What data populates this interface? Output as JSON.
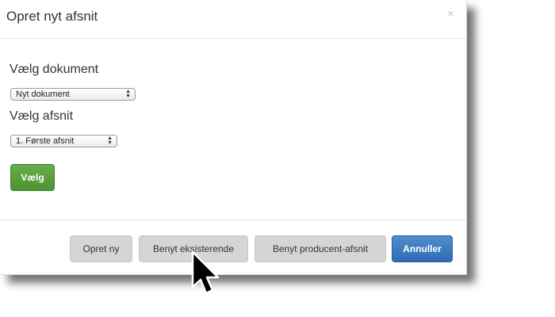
{
  "dialog": {
    "title": "Opret nyt afsnit",
    "close_symbol": "×"
  },
  "document_field": {
    "label": "Vælg dokument",
    "selected": "Nyt dokument"
  },
  "section_field": {
    "label": "Vælg afsnit",
    "selected": "1. Første afsnit"
  },
  "choose_button": {
    "label": "Vælg"
  },
  "footer": {
    "create_new_label": "Opret ny",
    "use_existing_label": "Benyt eksisterende",
    "use_producer_label": "Benyt producent-afsnit",
    "cancel_label": "Annuller"
  },
  "colors": {
    "primary_blue": "#3a7bc0",
    "success_green": "#5aa03f",
    "button_gray": "#d5d5d5"
  },
  "icons": {
    "close": "close-icon",
    "select_chevrons": "chevron-up-down-icon",
    "pointer": "mouse-pointer-icon"
  }
}
